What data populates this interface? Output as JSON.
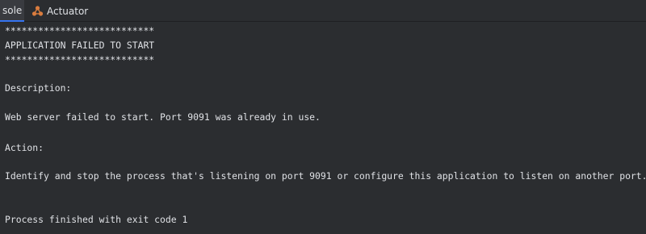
{
  "tabs": {
    "console_label": "sole",
    "actuator_label": "Actuator"
  },
  "console": {
    "lines": [
      "***************************",
      "APPLICATION FAILED TO START",
      "***************************",
      "Description:",
      "Web server failed to start. Port 9091 was already in use.",
      "Action:",
      "Identify and stop the process that's listening on port 9091 or configure this application to listen on another port.",
      "Process finished with exit code 1"
    ]
  },
  "icons": {
    "actuator": "actuator-icon"
  },
  "colors": {
    "background": "#2b2d30",
    "text": "#dfe1e5",
    "tab_accent": "#3574f0",
    "actuator_icon": "#d97c3e"
  }
}
